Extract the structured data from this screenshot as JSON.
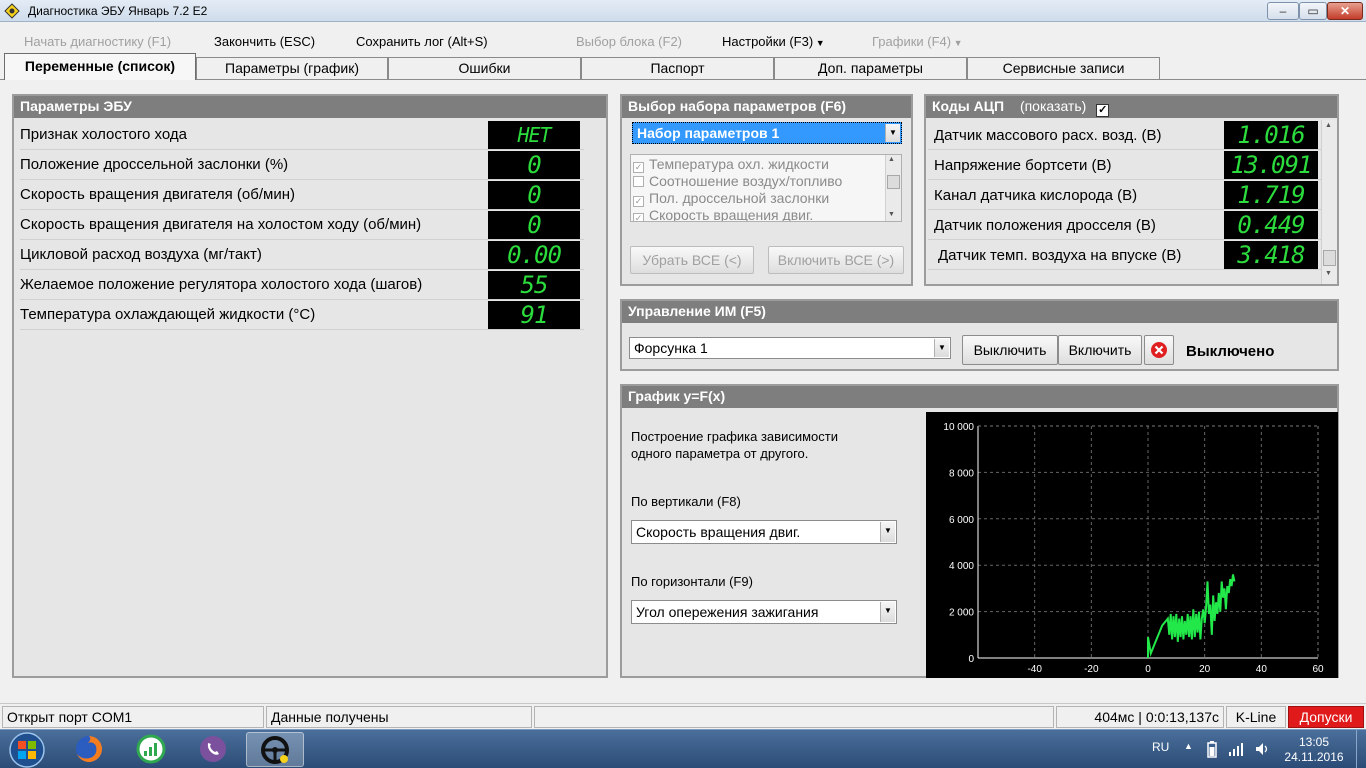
{
  "window": {
    "title": "Диагностика ЭБУ Январь 7.2 E2",
    "min_label": "‒",
    "max_label": "▭",
    "close_label": "✕"
  },
  "menu": {
    "start": "Начать диагностику (F1)",
    "finish": "Закончить (ESC)",
    "save_log": "Сохранить лог (Alt+S)",
    "select_block": "Выбор блока (F2)",
    "settings": "Настройки (F3)",
    "graphs": "Графики (F4)"
  },
  "tabs": [
    "Переменные (список)",
    "Параметры (график)",
    "Ошибки",
    "Паспорт",
    "Доп. параметры",
    "Сервисные записи"
  ],
  "ecu": {
    "title": "Параметры ЭБУ",
    "rows": [
      {
        "label": "Признак холостого хода",
        "value": "НЕТ"
      },
      {
        "label": "Положение дроссельной заслонки (%)",
        "value": "0"
      },
      {
        "label": "Скорость вращения двигателя (об/мин)",
        "value": "0"
      },
      {
        "label": "Скорость вращения двигателя на холостом ходу (об/мин)",
        "value": "0"
      },
      {
        "label": "Цикловой расход воздуха (мг/такт)",
        "value": "0.00"
      },
      {
        "label": "Желаемое положение регулятора холостого хода (шагов)",
        "value": "55"
      },
      {
        "label": "Температура охлаждающей жидкости (°C)",
        "value": "91"
      }
    ]
  },
  "param_set": {
    "title": "Выбор набора параметров (F6)",
    "selected": "Набор параметров 1",
    "items": [
      {
        "label": "Температура охл. жидкости",
        "checked": true
      },
      {
        "label": "Соотношение воздух/топливо",
        "checked": false
      },
      {
        "label": "Пол. дроссельной заслонки",
        "checked": true
      },
      {
        "label": "Скорость вращения двиг.",
        "checked": true
      }
    ],
    "remove_all": "Убрать ВСЕ (<)",
    "include_all": "Включить ВСЕ (>)"
  },
  "adc": {
    "title": "Коды АЦП",
    "show_label": "(показать)",
    "show_checked": true,
    "rows": [
      {
        "label": "Датчик массового расх. возд. (В)",
        "value": "1.016"
      },
      {
        "label": "Напряжение бортсети (В)",
        "value": "13.091"
      },
      {
        "label": "Канал датчика кислорода (В)",
        "value": "1.719"
      },
      {
        "label": "Датчик положения дросселя (В)",
        "value": "0.449"
      },
      {
        "label": "Датчик темп. воздуха на впуске (В)",
        "value": "3.418"
      }
    ]
  },
  "im": {
    "title": "Управление ИМ (F5)",
    "selected": "Форсунка 1",
    "off_button": "Выключить",
    "on_button": "Включить",
    "status": "Выключено"
  },
  "graph": {
    "title": "График y=F(x)",
    "desc_line1": "Построение графика зависимости",
    "desc_line2": "одного параметра от другого.",
    "vert_label": "По вертикали (F8)",
    "vert_value": "Скорость вращения двиг.",
    "horiz_label": "По горизонтали (F9)",
    "horiz_value": "Угол опережения зажигания"
  },
  "chart_data": {
    "type": "line",
    "title": "",
    "xlabel": "",
    "ylabel": "",
    "xlim": [
      -60,
      60
    ],
    "ylim": [
      0,
      10000
    ],
    "x_ticks": [
      -40,
      -20,
      0,
      20,
      40,
      60
    ],
    "y_ticks": [
      0,
      2000,
      4000,
      6000,
      8000,
      10000
    ],
    "x_tick_labels": [
      "-40",
      "-20",
      "0",
      "20",
      "40",
      "60"
    ],
    "y_tick_labels": [
      "0",
      "2 000",
      "4 000",
      "6 000",
      "8 000",
      "10 000"
    ],
    "grid": true,
    "line_color": "#22e84a",
    "series": [
      {
        "name": "",
        "x": [
          0,
          0,
          1,
          3,
          5,
          7,
          7.5,
          8,
          8.5,
          9,
          9.5,
          10,
          10.5,
          11,
          11.5,
          12,
          12.5,
          13,
          13.5,
          14,
          14.5,
          15,
          15.5,
          16,
          16.5,
          17,
          17.5,
          18,
          18.5,
          19,
          19.5,
          20,
          20.5,
          21,
          21.5,
          22,
          22.5,
          23,
          23.5,
          24,
          24.5,
          25,
          25.5,
          26,
          26.5,
          27,
          27.5,
          28,
          28.5,
          29,
          29.5,
          30,
          30.5
        ],
        "y": [
          0,
          900,
          200,
          800,
          1400,
          1700,
          1000,
          1900,
          800,
          1800,
          900,
          1900,
          700,
          1700,
          900,
          1800,
          800,
          1600,
          1000,
          1900,
          900,
          1800,
          800,
          2100,
          900,
          1900,
          1100,
          2000,
          800,
          1700,
          2100,
          1500,
          2200,
          3300,
          1900,
          2300,
          1000,
          2700,
          1600,
          2400,
          1900,
          2800,
          2000,
          3300,
          2600,
          3000,
          2100,
          3100,
          2800,
          3400,
          3100,
          3600,
          3300
        ]
      }
    ]
  },
  "status": {
    "port": "Открыт порт COM1",
    "data": "Данные получены",
    "empty": "",
    "time": "404мс | 0:0:13,137c",
    "protocol": "K-Line",
    "tolerances": "Допуски"
  },
  "taskbar": {
    "lang": "RU",
    "time": "13:05",
    "date": "24.11.2016"
  },
  "colors": {
    "lcd_green": "#2bdc3c",
    "panel_header": "#7e7e7e",
    "status_red": "#e0191b",
    "selection_blue": "#3399ff"
  }
}
